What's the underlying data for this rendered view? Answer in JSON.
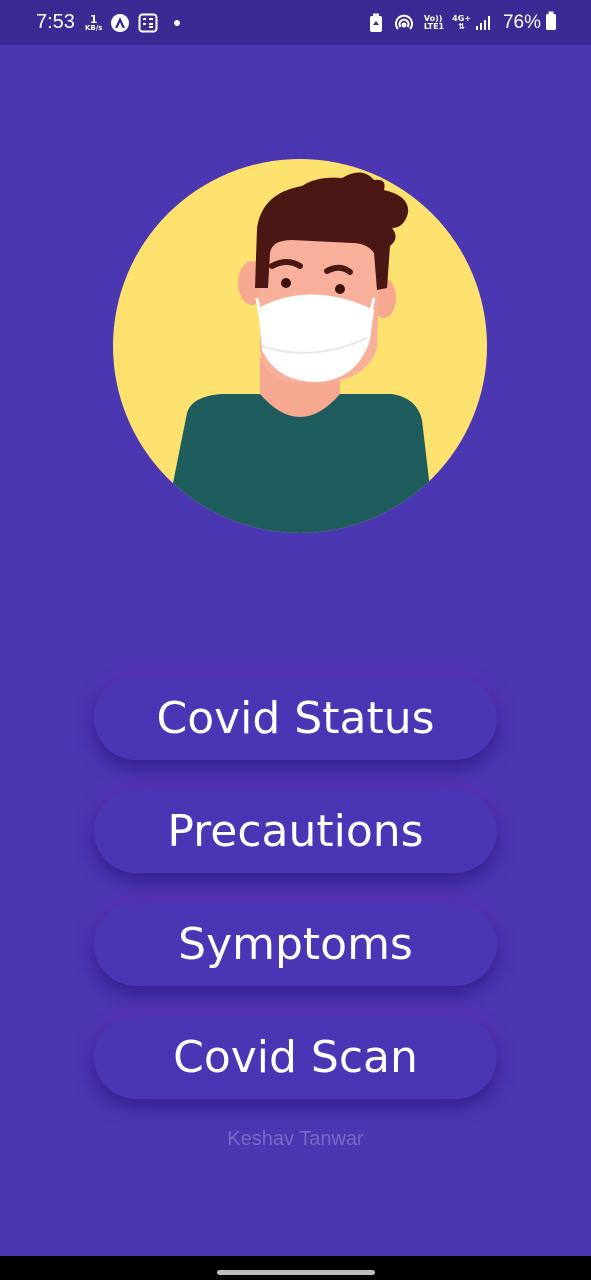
{
  "status_bar": {
    "time": "7:53",
    "speed_value": "1",
    "speed_unit": "KB/s",
    "volte_top": "Vo))",
    "volte_bottom": "LTE1",
    "network": "4G+",
    "battery_percent": "76%"
  },
  "menu": {
    "buttons": [
      {
        "label": "Covid Status"
      },
      {
        "label": "Precautions"
      },
      {
        "label": "Symptoms"
      },
      {
        "label": "Covid Scan"
      }
    ]
  },
  "footer": {
    "credit": "Keshav Tanwar"
  },
  "colors": {
    "background": "#4c37b3",
    "status_bar": "#3b2a93",
    "avatar_circle": "#fde26f",
    "shirt": "#1f5c5e",
    "hair": "#4a1714",
    "skin": "#f6a990"
  }
}
